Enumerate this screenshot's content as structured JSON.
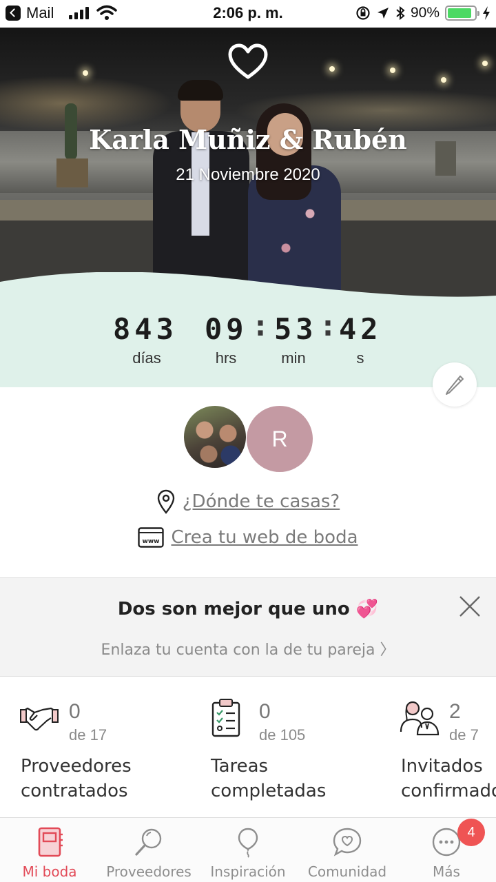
{
  "status_bar": {
    "back_app": "Mail",
    "time": "2:06 p. m.",
    "battery_text": "90%",
    "battery_level": 0.9
  },
  "hero": {
    "couple_names": "Karla Muñiz & Rubén",
    "wedding_date": "21 Noviembre 2020"
  },
  "countdown": {
    "days": "843",
    "hours": "09",
    "minutes": "53",
    "seconds": "42",
    "days_label": "días",
    "hours_label": "hrs",
    "minutes_label": "min",
    "seconds_label": "s",
    "separator": ":"
  },
  "couple": {
    "partner_initial": "R"
  },
  "links": {
    "location": "¿Dónde te casas?",
    "website": "Crea tu web de boda"
  },
  "partner_banner": {
    "title": "Dos son mejor que uno 💞",
    "subtitle": "Enlaza tu cuenta con la de tu pareja  〉"
  },
  "stats": [
    {
      "count": "0",
      "total": "de 17",
      "label_line1": "Proveedores",
      "label_line2": "contratados",
      "icon": "handshake-icon"
    },
    {
      "count": "0",
      "total": "de 105",
      "label_line1": "Tareas",
      "label_line2": "completadas",
      "icon": "clipboard-icon"
    },
    {
      "count": "2",
      "total": "de 7",
      "label_line1": "Invitados",
      "label_line2": "confirmados",
      "icon": "guests-icon"
    }
  ],
  "tabs": [
    {
      "label": "Mi boda",
      "icon": "notebook-icon",
      "active": true
    },
    {
      "label": "Proveedores",
      "icon": "magnifier-icon",
      "active": false
    },
    {
      "label": "Inspiración",
      "icon": "balloon-icon",
      "active": false
    },
    {
      "label": "Comunidad",
      "icon": "chat-heart-icon",
      "active": false
    },
    {
      "label": "Más",
      "icon": "more-icon",
      "active": false
    }
  ],
  "more_badge": "4",
  "colors": {
    "accent": "#e24a57",
    "countdown_bg": "#dff1ea",
    "avatar_initial_bg": "#c49aa3",
    "badge": "#ef5454"
  }
}
